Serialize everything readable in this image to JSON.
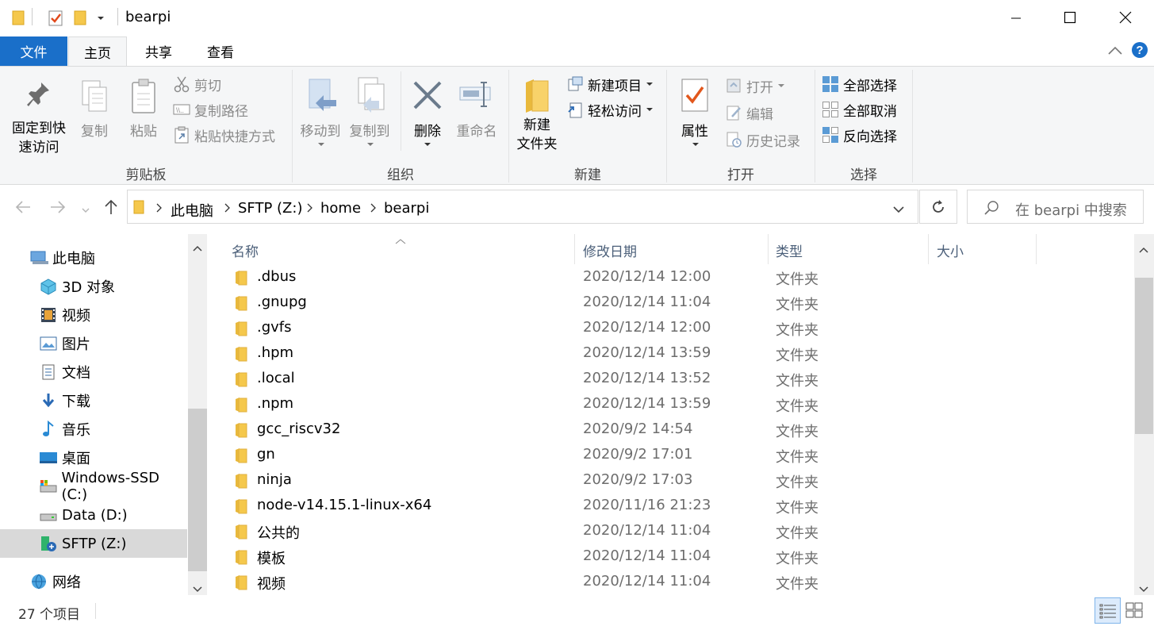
{
  "window": {
    "title": "bearpi"
  },
  "tabs": {
    "file": "文件",
    "home": "主页",
    "share": "共享",
    "view": "查看"
  },
  "ribbon": {
    "clipboard": {
      "label": "剪贴板",
      "pin": "固定到快速访问",
      "pin_line1": "固定到快",
      "pin_line2": "速访问",
      "copy": "复制",
      "paste": "粘贴",
      "cut": "剪切",
      "copy_path": "复制路径",
      "paste_shortcut": "粘贴快捷方式"
    },
    "organize": {
      "label": "组织",
      "move_to": "移动到",
      "copy_to": "复制到",
      "delete": "删除",
      "rename": "重命名"
    },
    "new": {
      "label": "新建",
      "new_folder_line1": "新建",
      "new_folder_line2": "文件夹",
      "new_item": "新建项目",
      "easy_access": "轻松访问"
    },
    "open": {
      "label": "打开",
      "properties": "属性",
      "open": "打开",
      "edit": "编辑",
      "history": "历史记录"
    },
    "select": {
      "label": "选择",
      "select_all": "全部选择",
      "select_none": "全部取消",
      "invert": "反向选择"
    }
  },
  "address": {
    "crumbs": [
      "此电脑",
      "SFTP (Z:)",
      "home",
      "bearpi"
    ],
    "search_placeholder": "在 bearpi 中搜索"
  },
  "nav": {
    "items": [
      {
        "label": "此电脑",
        "icon": "pc-icon"
      },
      {
        "label": "3D 对象",
        "icon": "3d-objects-icon"
      },
      {
        "label": "视频",
        "icon": "video-icon"
      },
      {
        "label": "图片",
        "icon": "pictures-icon"
      },
      {
        "label": "文档",
        "icon": "documents-icon"
      },
      {
        "label": "下载",
        "icon": "download-icon"
      },
      {
        "label": "音乐",
        "icon": "music-icon"
      },
      {
        "label": "桌面",
        "icon": "desktop-icon"
      },
      {
        "label": "Windows-SSD (C:)",
        "icon": "drive-icon"
      },
      {
        "label": "Data (D:)",
        "icon": "drive-icon"
      },
      {
        "label": "SFTP (Z:)",
        "icon": "network-drive-icon",
        "selected": true
      },
      {
        "label": "网络",
        "icon": "network-icon"
      }
    ]
  },
  "columns": {
    "name": "名称",
    "modified": "修改日期",
    "type": "类型",
    "size": "大小"
  },
  "files": [
    {
      "name": ".dbus",
      "date": "2020/12/14 12:00",
      "type": "文件夹"
    },
    {
      "name": ".gnupg",
      "date": "2020/12/14 11:04",
      "type": "文件夹"
    },
    {
      "name": ".gvfs",
      "date": "2020/12/14 12:00",
      "type": "文件夹"
    },
    {
      "name": ".hpm",
      "date": "2020/12/14 13:59",
      "type": "文件夹"
    },
    {
      "name": ".local",
      "date": "2020/12/14 13:52",
      "type": "文件夹"
    },
    {
      "name": ".npm",
      "date": "2020/12/14 13:59",
      "type": "文件夹"
    },
    {
      "name": "gcc_riscv32",
      "date": "2020/9/2 14:54",
      "type": "文件夹"
    },
    {
      "name": "gn",
      "date": "2020/9/2 17:01",
      "type": "文件夹"
    },
    {
      "name": "ninja",
      "date": "2020/9/2 17:03",
      "type": "文件夹"
    },
    {
      "name": "node-v14.15.1-linux-x64",
      "date": "2020/11/16 21:23",
      "type": "文件夹"
    },
    {
      "name": "公共的",
      "date": "2020/12/14 11:04",
      "type": "文件夹"
    },
    {
      "name": "模板",
      "date": "2020/12/14 11:04",
      "type": "文件夹"
    },
    {
      "name": "视频",
      "date": "2020/12/14 11:04",
      "type": "文件夹"
    }
  ],
  "status": {
    "count": "27 个项目"
  },
  "colors": {
    "accent": "#1a6fc9",
    "folder": "#f5c84c",
    "ribbon_bg": "#f5f6f7"
  }
}
